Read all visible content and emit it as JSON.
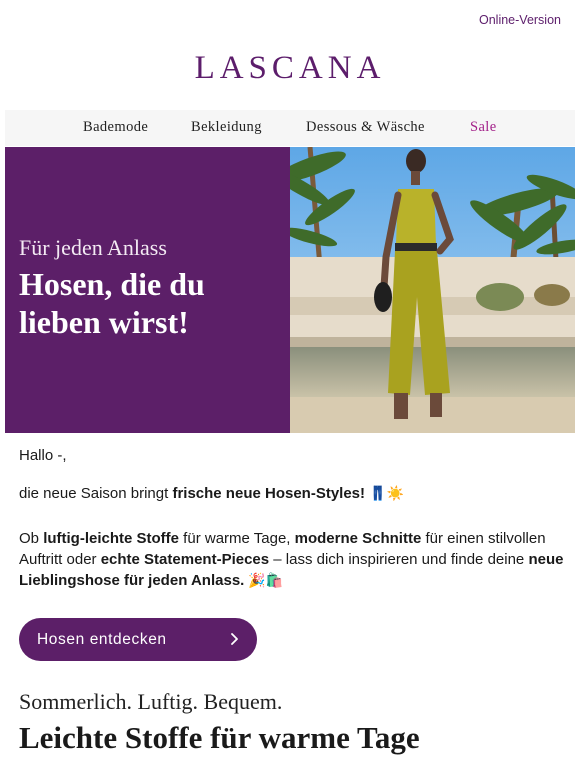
{
  "header": {
    "online_version": "Online-Version",
    "logo": "LASCANA"
  },
  "nav": {
    "items": [
      {
        "label": "Bademode"
      },
      {
        "label": "Bekleidung"
      },
      {
        "label": "Dessous & Wäsche"
      },
      {
        "label": "Sale"
      }
    ]
  },
  "hero": {
    "kicker": "Für jeden Anlass",
    "title": "Hosen, die du lieben wirst!"
  },
  "body": {
    "greeting": "Hallo -,",
    "para1_pre": "die neue Saison bringt ",
    "para1_bold": "frische neue Hosen-Styles!",
    "para1_emoji": "👖☀️",
    "para2": [
      {
        "text": "Ob ",
        "bold": false
      },
      {
        "text": "luftig-leichte Stoffe",
        "bold": true
      },
      {
        "text": " für warme Tage, ",
        "bold": false
      },
      {
        "text": "moderne Schnitte",
        "bold": true
      },
      {
        "text": " für einen stilvollen Auftritt oder ",
        "bold": false
      },
      {
        "text": "echte Statement-Pieces",
        "bold": true
      },
      {
        "text": " – lass dich inspirieren und finde deine ",
        "bold": false
      },
      {
        "text": "neue Lieblingshose für jeden Anlass.",
        "bold": true
      },
      {
        "text": " 🎉🛍️",
        "bold": false
      }
    ]
  },
  "cta": {
    "label": "Hosen entdecken"
  },
  "section": {
    "subtitle": "Sommerlich. Luftig. Bequem.",
    "title": "Leichte Stoffe für warme Tage"
  },
  "colors": {
    "brand_purple": "#5c1f68",
    "sale_pink": "#a3228a"
  }
}
